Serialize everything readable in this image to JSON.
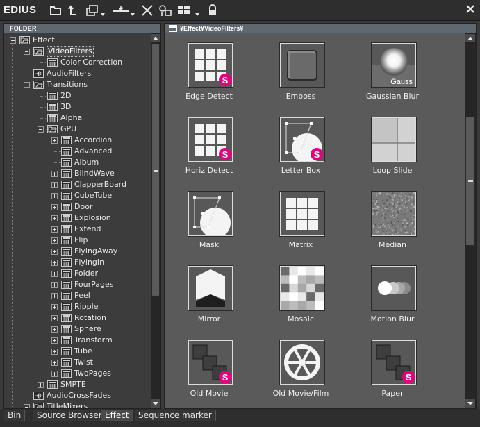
{
  "app": {
    "title": "EDIUS"
  },
  "toolbar": {
    "icons": [
      "new-folder-icon",
      "up-folder-icon",
      "copy-icon",
      "cut-icon",
      "delete-icon",
      "properties-icon",
      "view-mode-icon",
      "lock-icon"
    ]
  },
  "left_panel": {
    "header": "FOLDER"
  },
  "tree": [
    {
      "label": "Effect",
      "expander": "minus"
    },
    {
      "label": "VideoFilters",
      "expander": "minus",
      "selected": true
    },
    {
      "label": "Color Correction"
    },
    {
      "label": "AudioFilters"
    },
    {
      "label": "Transitions",
      "expander": "minus"
    },
    {
      "label": "2D"
    },
    {
      "label": "3D"
    },
    {
      "label": "Alpha"
    },
    {
      "label": "GPU",
      "expander": "minus"
    },
    {
      "label": "Accordion",
      "expander": "plus"
    },
    {
      "label": "Advanced"
    },
    {
      "label": "Album"
    },
    {
      "label": "BlindWave",
      "expander": "plus"
    },
    {
      "label": "ClapperBoard",
      "expander": "plus"
    },
    {
      "label": "CubeTube",
      "expander": "plus"
    },
    {
      "label": "Door",
      "expander": "plus"
    },
    {
      "label": "Explosion",
      "expander": "plus"
    },
    {
      "label": "Extend",
      "expander": "plus"
    },
    {
      "label": "Flip",
      "expander": "plus"
    },
    {
      "label": "FlyingAway",
      "expander": "plus"
    },
    {
      "label": "FlyingIn",
      "expander": "plus"
    },
    {
      "label": "Folder",
      "expander": "plus"
    },
    {
      "label": "FourPages",
      "expander": "plus"
    },
    {
      "label": "Peel",
      "expander": "plus"
    },
    {
      "label": "Ripple",
      "expander": "plus"
    },
    {
      "label": "Rotation",
      "expander": "plus"
    },
    {
      "label": "Sphere",
      "expander": "plus"
    },
    {
      "label": "Transform",
      "expander": "plus"
    },
    {
      "label": "Tube",
      "expander": "plus"
    },
    {
      "label": "Twist",
      "expander": "plus"
    },
    {
      "label": "TwoPages",
      "expander": "plus"
    },
    {
      "label": "SMPTE",
      "expander": "plus"
    },
    {
      "label": "AudioCrossFades"
    },
    {
      "label": "TitleMixers",
      "expander": "minus"
    }
  ],
  "right_panel": {
    "path": "¥Effect¥VideoFilters¥"
  },
  "effects": [
    {
      "label": "Edge Detect",
      "thumb": "grid",
      "badge": "S"
    },
    {
      "label": "Emboss",
      "thumb": "emboss"
    },
    {
      "label": "Gaussian Blur",
      "thumb": "gauss",
      "thumb_text": "Gauss"
    },
    {
      "label": "Horiz Detect",
      "thumb": "grid",
      "badge": "S"
    },
    {
      "label": "Letter Box",
      "thumb": "mask",
      "badge": "S"
    },
    {
      "label": "Loop Slide",
      "thumb": "loop"
    },
    {
      "label": "Mask",
      "thumb": "mask"
    },
    {
      "label": "Matrix",
      "thumb": "grid"
    },
    {
      "label": "Median",
      "thumb": "noise"
    },
    {
      "label": "Mirror",
      "thumb": "mirror"
    },
    {
      "label": "Mosaic",
      "thumb": "mosaic"
    },
    {
      "label": "Motion Blur",
      "thumb": "motion"
    },
    {
      "label": "Old Movie",
      "thumb": "frames",
      "badge": "S"
    },
    {
      "label": "Old Movie/Film",
      "thumb": "reel"
    },
    {
      "label": "Paper",
      "thumb": "frames",
      "badge": "S"
    }
  ],
  "tabs": [
    {
      "label": "Bin"
    },
    {
      "label": "Source Browser"
    },
    {
      "label": "Effect",
      "active": true
    },
    {
      "label": "Sequence marker"
    }
  ],
  "colors": {
    "header_bg": "#5f6771",
    "badge": "#e6007e",
    "panel_bg": "#5a5a5a"
  }
}
